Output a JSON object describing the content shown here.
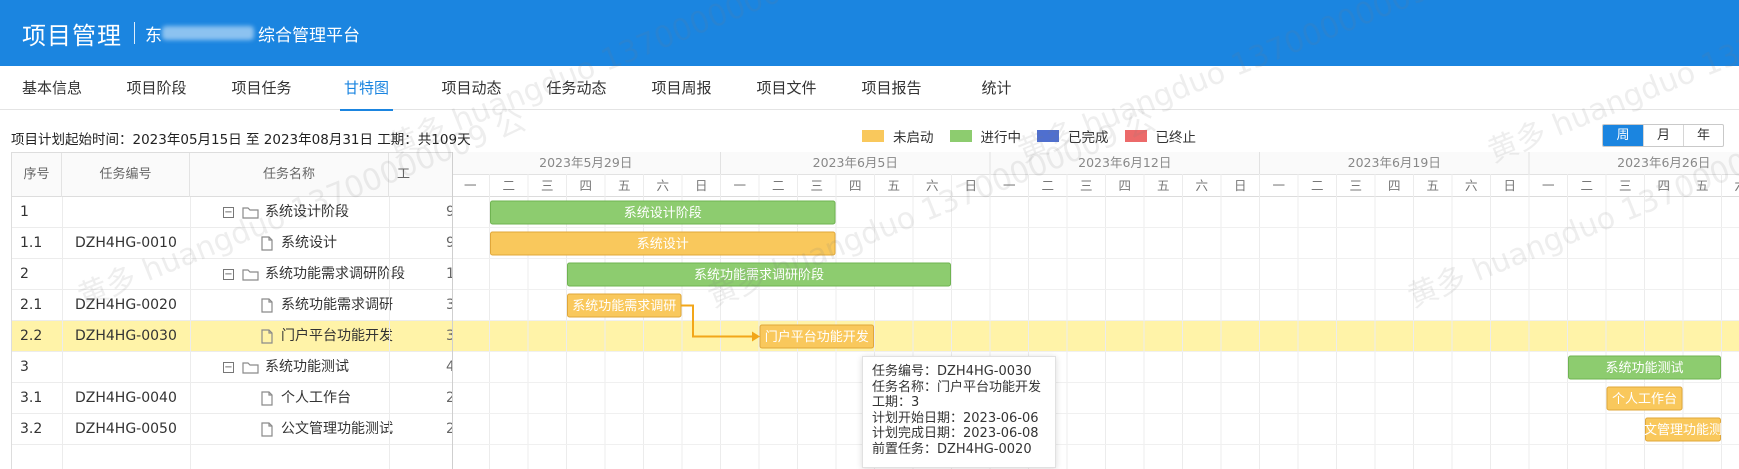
{
  "header": {
    "title": "项目管理",
    "subtitle": "综合管理平台",
    "subtitle_prefix": "东"
  },
  "tabs": [
    {
      "label": "基本信息",
      "active": false
    },
    {
      "label": "项目阶段",
      "active": false
    },
    {
      "label": "项目任务",
      "active": false
    },
    {
      "label": "甘特图",
      "active": true
    },
    {
      "label": "项目动态",
      "active": false
    },
    {
      "label": "任务动态",
      "active": false
    },
    {
      "label": "项目周报",
      "active": false
    },
    {
      "label": "项目文件",
      "active": false
    },
    {
      "label": "项目报告",
      "active": false
    },
    {
      "label": "统计",
      "active": false
    }
  ],
  "plan_text": "项目计划起始时间：2023年05月15日 至 2023年08月31日 工期：共109天",
  "legend": [
    {
      "label": "未启动",
      "color": "#f9c85c"
    },
    {
      "label": "进行中",
      "color": "#8dcc6f"
    },
    {
      "label": "已完成",
      "color": "#4f6fcf"
    },
    {
      "label": "已终止",
      "color": "#ec6a6a"
    }
  ],
  "scale_buttons": [
    {
      "label": "周",
      "active": true
    },
    {
      "label": "月",
      "active": false
    },
    {
      "label": "年",
      "active": false
    }
  ],
  "grid_headers": {
    "seq": "序号",
    "code": "任务编号",
    "name": "任务名称",
    "duration": "工"
  },
  "rows": [
    {
      "seq": "1",
      "code": "",
      "name": "系统设计阶段",
      "type": "phase",
      "dur": "9"
    },
    {
      "seq": "1.1",
      "code": "DZH4HG-0010",
      "name": "系统设计",
      "type": "task",
      "dur": "9"
    },
    {
      "seq": "2",
      "code": "",
      "name": "系统功能需求调研阶段",
      "type": "phase",
      "dur": "1"
    },
    {
      "seq": "2.1",
      "code": "DZH4HG-0020",
      "name": "系统功能需求调研",
      "type": "task",
      "dur": "3"
    },
    {
      "seq": "2.2",
      "code": "DZH4HG-0030",
      "name": "门户平台功能开发",
      "type": "task",
      "dur": "3",
      "selected": true
    },
    {
      "seq": "3",
      "code": "",
      "name": "系统功能测试",
      "type": "phase",
      "dur": "4"
    },
    {
      "seq": "3.1",
      "code": "DZH4HG-0040",
      "name": "个人工作台",
      "type": "task",
      "dur": "2"
    },
    {
      "seq": "3.2",
      "code": "DZH4HG-0050",
      "name": "公文管理功能测试",
      "type": "task",
      "dur": "2"
    }
  ],
  "weeks": [
    "2023年5月29日",
    "2023年6月5日",
    "2023年6月12日",
    "2023年6月19日",
    "2023年6月26日"
  ],
  "weekdays": [
    "一",
    "二",
    "三",
    "四",
    "五",
    "六",
    "日"
  ],
  "bars": [
    {
      "row": 0,
      "label": "系统设计阶段",
      "start": 1,
      "end": 10,
      "status": "in-progress"
    },
    {
      "row": 1,
      "label": "系统设计",
      "start": 1,
      "end": 10,
      "status": "not-started"
    },
    {
      "row": 2,
      "label": "系统功能需求调研阶段",
      "start": 3,
      "end": 13,
      "status": "in-progress"
    },
    {
      "row": 3,
      "label": "系统功能需求调研",
      "start": 3,
      "end": 6,
      "status": "not-started"
    },
    {
      "row": 4,
      "label": "门户平台功能开发",
      "start": 8,
      "end": 11,
      "status": "not-started"
    },
    {
      "row": 5,
      "label": "系统功能测试",
      "start": 29,
      "end": 33,
      "status": "in-progress"
    },
    {
      "row": 6,
      "label": "个人工作台",
      "start": 30,
      "end": 32,
      "status": "not-started"
    },
    {
      "row": 7,
      "label": "公文管理功能测试",
      "start": 31,
      "end": 33,
      "status": "not-started"
    }
  ],
  "dependency": {
    "from_row": 3,
    "to_row": 4
  },
  "tooltip": [
    "任务编号：DZH4HG-0030",
    "任务名称：门户平台功能开发",
    "工期：3",
    "计划开始日期：2023-06-06",
    "计划完成日期：2023-06-08",
    "前置任务：DZH4HG-0020"
  ],
  "watermark": "黄多 huangduo 13700000009 公"
}
